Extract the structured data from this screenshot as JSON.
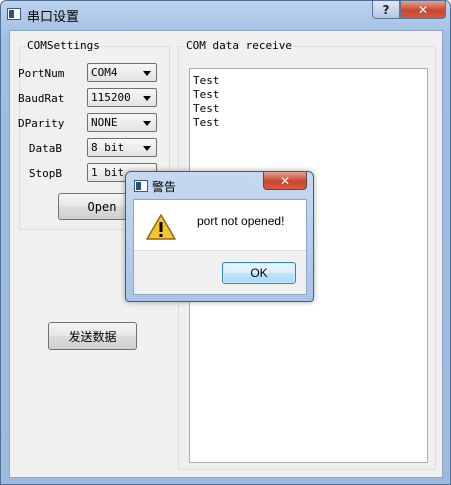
{
  "window": {
    "title": "串口设置",
    "help_label": "?",
    "close_label": "✕"
  },
  "com_settings": {
    "group_title": "COMSettings",
    "rows": [
      {
        "label": "PortNum",
        "value": "COM4"
      },
      {
        "label": "BaudRat",
        "value": "115200"
      },
      {
        "label": "DParity",
        "value": "NONE"
      },
      {
        "label": "DataB",
        "value": "8 bit"
      },
      {
        "label": "StopB",
        "value": "1 bit"
      }
    ],
    "open_label": "Open"
  },
  "send_button_label": "发送数据",
  "receive": {
    "group_title": "COM data receive",
    "lines": [
      "Test",
      "Test",
      "Test",
      "Test"
    ]
  },
  "dialog": {
    "title": "警告",
    "close_label": "✕",
    "message": "port not opened!",
    "ok_label": "OK",
    "icon": "warning-icon",
    "colors": {
      "warning_fill": "#f5c52c",
      "warning_stroke": "#8a6d12"
    }
  }
}
